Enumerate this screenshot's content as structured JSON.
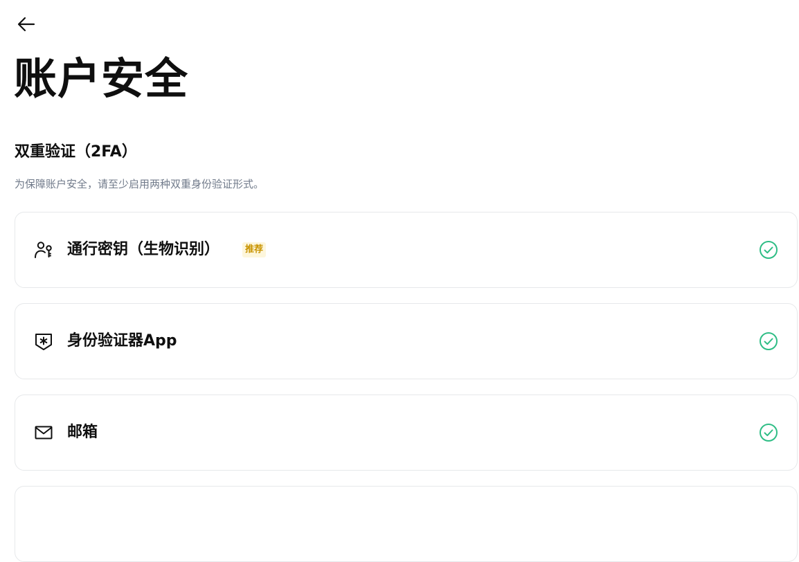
{
  "header": {
    "back_icon": "arrow-left-icon",
    "title": "账户安全"
  },
  "section": {
    "title": "双重验证（2FA）",
    "description": "为保障账户安全，请至少启用两种双重身份验证形式。"
  },
  "methods": [
    {
      "label": "通行密钥（生物识别）",
      "icon": "passkey-user-icon",
      "badge": "推荐",
      "status_icon": "check-circle-icon"
    },
    {
      "label": "身份验证器App",
      "icon": "authenticator-shield-icon",
      "status_icon": "check-circle-icon"
    },
    {
      "label": "邮箱",
      "icon": "mail-icon",
      "status_icon": "check-circle-icon"
    }
  ],
  "colors": {
    "success": "#2ebd85",
    "badge_text": "#c99400",
    "badge_bg": "#fdf6dc",
    "muted_text": "#707a8a",
    "border": "#e6e8ea"
  }
}
